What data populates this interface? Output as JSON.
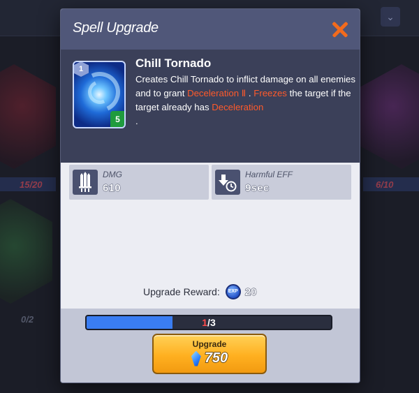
{
  "background": {
    "counts": [
      "15/20",
      "6/10",
      "0/2"
    ]
  },
  "dialog": {
    "title": "Spell Upgrade",
    "close_icon": "close-icon"
  },
  "spell": {
    "name": "Chill Tornado",
    "level": "1",
    "cost": "5",
    "description": {
      "part1": "Creates Chill Tornado to inflict damage on all enemies and to grant ",
      "highlight1": "Deceleration Ⅱ",
      "part2": " . ",
      "highlight2": "Freezes",
      "part3": " the target if the target already has ",
      "highlight3": "Deceleration",
      "part4": " ."
    }
  },
  "stats": {
    "dmg": {
      "label": "DMG",
      "value": "610",
      "icon": "damage-swords-icon"
    },
    "harmful_eff": {
      "label": "Harmful EFF",
      "value": "9sec",
      "icon": "duration-timer-icon"
    }
  },
  "reward": {
    "label": "Upgrade Reward:",
    "icon": "exp-orb-icon",
    "icon_text": "EXP",
    "value": "20"
  },
  "progress": {
    "current": "1",
    "separator": "/",
    "total": "3",
    "fraction": 0.35
  },
  "upgrade_button": {
    "label": "Upgrade",
    "icon": "gem-icon",
    "cost": "750"
  },
  "colors": {
    "header": "#505779",
    "highlight": "#ff5a2b",
    "close": "#f36b1c",
    "button": "#ffb020",
    "progress_fill": "#3a7df2"
  }
}
